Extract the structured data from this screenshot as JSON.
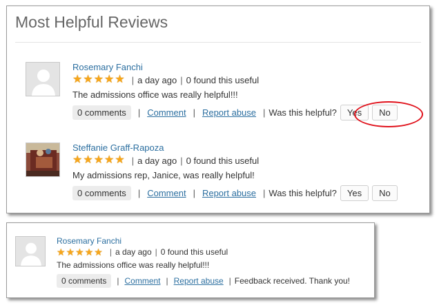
{
  "top_panel": {
    "title": "Most Helpful Reviews",
    "reviews": [
      {
        "reviewer": "Rosemary Fanchi",
        "rating": 5,
        "time": "a day ago",
        "useful": "0 found this useful",
        "text": "The admissions office was really helpful!!!",
        "comments": "0 comments",
        "comment_link": "Comment",
        "report_link": "Report abuse",
        "helpful_question": "Was this helpful?",
        "yes": "Yes",
        "no": "No"
      },
      {
        "reviewer": "Steffanie Graff-Rapoza",
        "rating": 5,
        "time": "a day ago",
        "useful": "0 found this useful",
        "text": "My admissions rep, Janice, was really helpful!",
        "comments": "0 comments",
        "comment_link": "Comment",
        "report_link": "Report abuse",
        "helpful_question": "Was this helpful?",
        "yes": "Yes",
        "no": "No"
      }
    ]
  },
  "bottom_panel": {
    "review": {
      "reviewer": "Rosemary Fanchi",
      "rating": 5,
      "time": "a day ago",
      "useful": "0 found this useful",
      "text": "The admissions office was really helpful!!!",
      "comments": "0 comments",
      "comment_link": "Comment",
      "report_link": "Report abuse",
      "feedback": "Feedback received. Thank you!"
    }
  },
  "colors": {
    "link": "#2c6fa0",
    "star": "#f6a61b",
    "highlight": "#e0101a"
  },
  "icons": [
    "star-icon",
    "default-avatar-icon",
    "photo-avatar"
  ]
}
